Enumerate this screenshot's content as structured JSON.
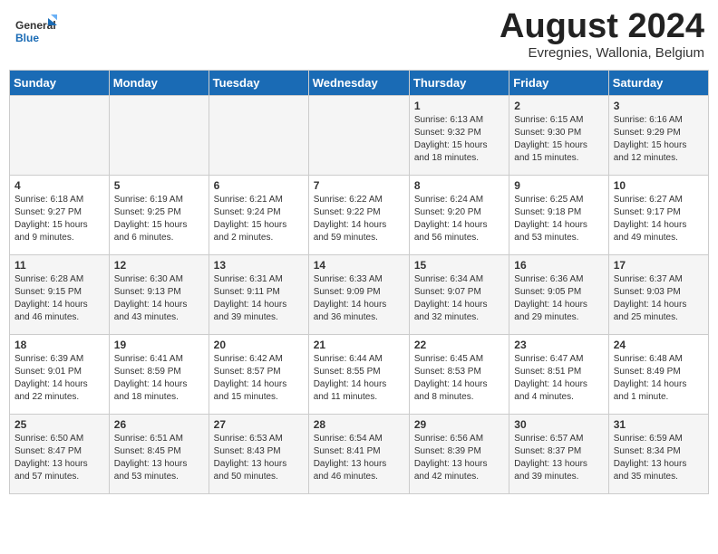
{
  "header": {
    "logo_line1": "General",
    "logo_line2": "Blue",
    "month_year": "August 2024",
    "location": "Evregnies, Wallonia, Belgium"
  },
  "weekdays": [
    "Sunday",
    "Monday",
    "Tuesday",
    "Wednesday",
    "Thursday",
    "Friday",
    "Saturday"
  ],
  "weeks": [
    [
      {
        "day": "",
        "text": ""
      },
      {
        "day": "",
        "text": ""
      },
      {
        "day": "",
        "text": ""
      },
      {
        "day": "",
        "text": ""
      },
      {
        "day": "1",
        "text": "Sunrise: 6:13 AM\nSunset: 9:32 PM\nDaylight: 15 hours\nand 18 minutes."
      },
      {
        "day": "2",
        "text": "Sunrise: 6:15 AM\nSunset: 9:30 PM\nDaylight: 15 hours\nand 15 minutes."
      },
      {
        "day": "3",
        "text": "Sunrise: 6:16 AM\nSunset: 9:29 PM\nDaylight: 15 hours\nand 12 minutes."
      }
    ],
    [
      {
        "day": "4",
        "text": "Sunrise: 6:18 AM\nSunset: 9:27 PM\nDaylight: 15 hours\nand 9 minutes."
      },
      {
        "day": "5",
        "text": "Sunrise: 6:19 AM\nSunset: 9:25 PM\nDaylight: 15 hours\nand 6 minutes."
      },
      {
        "day": "6",
        "text": "Sunrise: 6:21 AM\nSunset: 9:24 PM\nDaylight: 15 hours\nand 2 minutes."
      },
      {
        "day": "7",
        "text": "Sunrise: 6:22 AM\nSunset: 9:22 PM\nDaylight: 14 hours\nand 59 minutes."
      },
      {
        "day": "8",
        "text": "Sunrise: 6:24 AM\nSunset: 9:20 PM\nDaylight: 14 hours\nand 56 minutes."
      },
      {
        "day": "9",
        "text": "Sunrise: 6:25 AM\nSunset: 9:18 PM\nDaylight: 14 hours\nand 53 minutes."
      },
      {
        "day": "10",
        "text": "Sunrise: 6:27 AM\nSunset: 9:17 PM\nDaylight: 14 hours\nand 49 minutes."
      }
    ],
    [
      {
        "day": "11",
        "text": "Sunrise: 6:28 AM\nSunset: 9:15 PM\nDaylight: 14 hours\nand 46 minutes."
      },
      {
        "day": "12",
        "text": "Sunrise: 6:30 AM\nSunset: 9:13 PM\nDaylight: 14 hours\nand 43 minutes."
      },
      {
        "day": "13",
        "text": "Sunrise: 6:31 AM\nSunset: 9:11 PM\nDaylight: 14 hours\nand 39 minutes."
      },
      {
        "day": "14",
        "text": "Sunrise: 6:33 AM\nSunset: 9:09 PM\nDaylight: 14 hours\nand 36 minutes."
      },
      {
        "day": "15",
        "text": "Sunrise: 6:34 AM\nSunset: 9:07 PM\nDaylight: 14 hours\nand 32 minutes."
      },
      {
        "day": "16",
        "text": "Sunrise: 6:36 AM\nSunset: 9:05 PM\nDaylight: 14 hours\nand 29 minutes."
      },
      {
        "day": "17",
        "text": "Sunrise: 6:37 AM\nSunset: 9:03 PM\nDaylight: 14 hours\nand 25 minutes."
      }
    ],
    [
      {
        "day": "18",
        "text": "Sunrise: 6:39 AM\nSunset: 9:01 PM\nDaylight: 14 hours\nand 22 minutes."
      },
      {
        "day": "19",
        "text": "Sunrise: 6:41 AM\nSunset: 8:59 PM\nDaylight: 14 hours\nand 18 minutes."
      },
      {
        "day": "20",
        "text": "Sunrise: 6:42 AM\nSunset: 8:57 PM\nDaylight: 14 hours\nand 15 minutes."
      },
      {
        "day": "21",
        "text": "Sunrise: 6:44 AM\nSunset: 8:55 PM\nDaylight: 14 hours\nand 11 minutes."
      },
      {
        "day": "22",
        "text": "Sunrise: 6:45 AM\nSunset: 8:53 PM\nDaylight: 14 hours\nand 8 minutes."
      },
      {
        "day": "23",
        "text": "Sunrise: 6:47 AM\nSunset: 8:51 PM\nDaylight: 14 hours\nand 4 minutes."
      },
      {
        "day": "24",
        "text": "Sunrise: 6:48 AM\nSunset: 8:49 PM\nDaylight: 14 hours\nand 1 minute."
      }
    ],
    [
      {
        "day": "25",
        "text": "Sunrise: 6:50 AM\nSunset: 8:47 PM\nDaylight: 13 hours\nand 57 minutes."
      },
      {
        "day": "26",
        "text": "Sunrise: 6:51 AM\nSunset: 8:45 PM\nDaylight: 13 hours\nand 53 minutes."
      },
      {
        "day": "27",
        "text": "Sunrise: 6:53 AM\nSunset: 8:43 PM\nDaylight: 13 hours\nand 50 minutes."
      },
      {
        "day": "28",
        "text": "Sunrise: 6:54 AM\nSunset: 8:41 PM\nDaylight: 13 hours\nand 46 minutes."
      },
      {
        "day": "29",
        "text": "Sunrise: 6:56 AM\nSunset: 8:39 PM\nDaylight: 13 hours\nand 42 minutes."
      },
      {
        "day": "30",
        "text": "Sunrise: 6:57 AM\nSunset: 8:37 PM\nDaylight: 13 hours\nand 39 minutes."
      },
      {
        "day": "31",
        "text": "Sunrise: 6:59 AM\nSunset: 8:34 PM\nDaylight: 13 hours\nand 35 minutes."
      }
    ]
  ]
}
